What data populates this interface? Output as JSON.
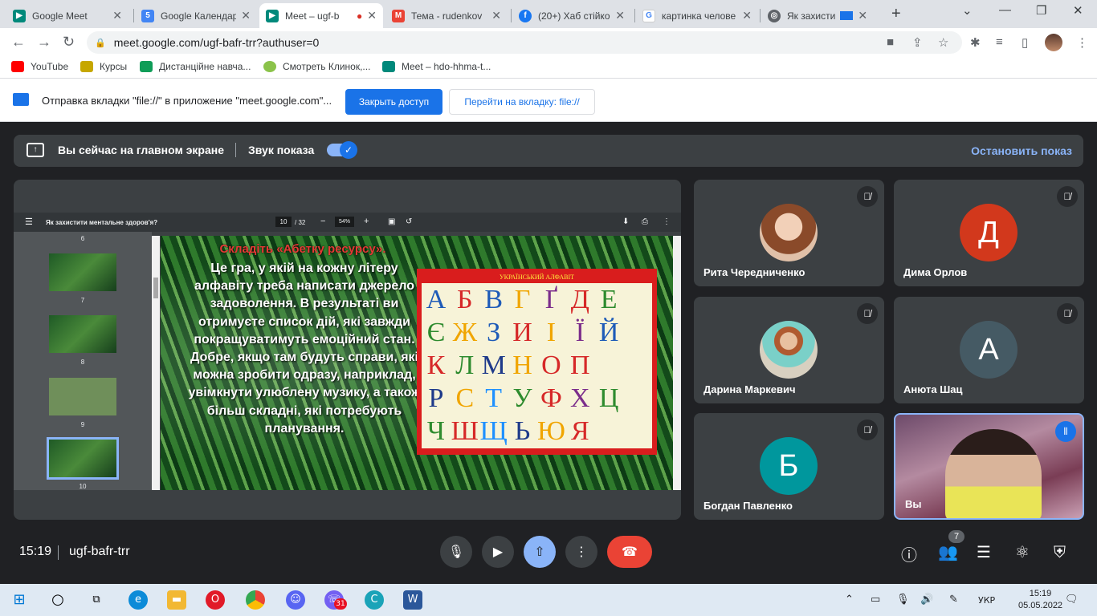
{
  "tabs": [
    {
      "title": "Google Meet",
      "fav_color": "#00897b",
      "fav_glyph": "▶"
    },
    {
      "title": "Google Календар",
      "fav_color": "#4285f4",
      "fav_glyph": "5"
    },
    {
      "title": "Meet – ugf-b",
      "fav_color": "#00897b",
      "fav_glyph": "▶"
    },
    {
      "title": "Тема - rudenkov",
      "fav_color": "#ea4335",
      "fav_glyph": "M"
    },
    {
      "title": "(20+) Хаб стійкос",
      "fav_color": "#1877f2",
      "fav_glyph": "f"
    },
    {
      "title": "картинка челове",
      "fav_color": "#4285f4",
      "fav_glyph": "G"
    },
    {
      "title": "Як захисти",
      "fav_color": "#5f6368",
      "fav_glyph": "◎"
    }
  ],
  "address": "meet.google.com/ugf-bafr-trr?authuser=0",
  "bookmarks": [
    {
      "label": "YouTube",
      "color": "#ff0000"
    },
    {
      "label": "Курсы",
      "color": "#c6a700"
    },
    {
      "label": "Дистанційне навча...",
      "color": "#0f9d58"
    },
    {
      "label": "Смотреть Клинок,...",
      "color": "#8bc34a"
    },
    {
      "label": "Meet – hdo-hhma-t...",
      "color": "#00897b"
    }
  ],
  "infobar": {
    "message": "Отправка вкладки \"file://\" в приложение \"meet.google.com\"...",
    "primary": "Закрыть доступ",
    "secondary": "Перейти на вкладку: file://"
  },
  "sharebar": {
    "presenting": "Вы сейчас на главном экране",
    "sound": "Звук показа",
    "stop": "Остановить показ"
  },
  "pdf": {
    "title": "Як захистити ментальне здоров'я?",
    "page": "10",
    "total": "/ 32",
    "zoom": "54%",
    "thumb_labels": [
      "6",
      "7",
      "8",
      "9",
      "10"
    ]
  },
  "slide": {
    "title": "Складіть «Абетку ресурсу».",
    "body": "Це гра, у якій на кожну літеру алфавіту треба написати джерело задоволення. В результаті ви отримуєте список дій, які завжди покращуватимуть емоційний стан. Добре, якщо там будуть справи, які можна зробити одразу, наприклад, увімкнути улюблену музику, а також більш складні, які потребують планування.",
    "alphabet_title": "УКРАЇНСЬКИЙ АЛФАВІТ",
    "letters": [
      "А",
      "Б",
      "В",
      "Г",
      "Ґ",
      "Д",
      "Е",
      "",
      "Є",
      "Ж",
      "З",
      "И",
      "І",
      "Ї",
      "Й",
      "",
      "К",
      "Л",
      "М",
      "Н",
      "О",
      "П",
      "",
      "",
      "Р",
      "С",
      "Т",
      "У",
      "Ф",
      "Х",
      "Ц",
      "",
      "Ч",
      "Ш",
      "Щ",
      "Ь",
      "Ю",
      "Я",
      "",
      ""
    ],
    "letter_colors": [
      "#1e5bb8",
      "#d62828",
      "#1e5bb8",
      "#f0a500",
      "#7b2d8b",
      "#d62828",
      "#2e8b2e",
      "",
      "#2e8b2e",
      "#f0a500",
      "#1e5bb8",
      "#d62828",
      "#f0a500",
      "#7b2d8b",
      "#1e5bb8",
      "",
      "#d62828",
      "#2e8b2e",
      "#1e3a8a",
      "#f0a500",
      "#d62828",
      "#d62828",
      "",
      "",
      "#1e3a8a",
      "#f0a500",
      "#1e90ff",
      "#2e8b2e",
      "#d62828",
      "#7b2d8b",
      "#2e8b2e",
      "",
      "#2e8b2e",
      "#d62828",
      "#1e90ff",
      "#1e3a8a",
      "#f0a500",
      "#d62828",
      "",
      ""
    ]
  },
  "participants": [
    {
      "name": "Рита Чередниченко",
      "initial": "",
      "color": "#c49a7a"
    },
    {
      "name": "Дима Орлов",
      "initial": "Д",
      "color": "#d2381c"
    },
    {
      "name": "Дарина Маркевич",
      "initial": "",
      "color": "#a07a5a"
    },
    {
      "name": "Анюта Шац",
      "initial": "А",
      "color": "#455a64"
    },
    {
      "name": "Богдан Павленко",
      "initial": "Б",
      "color": "#00979d"
    },
    {
      "name": "Вы",
      "initial": "",
      "color": ""
    }
  ],
  "meeting": {
    "time": "15:19",
    "code": "ugf-bafr-trr",
    "people_count": "7"
  },
  "taskbar": {
    "lang": "УКР",
    "time": "15:19",
    "date": "05.05.2022",
    "viber_badge": "31"
  }
}
